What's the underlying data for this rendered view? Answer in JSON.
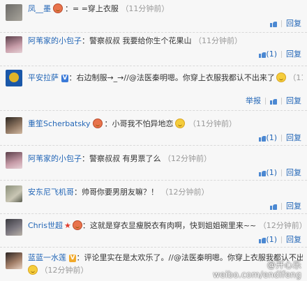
{
  "comments": [
    {
      "user": "凤__墨",
      "text": "= =穿上衣服",
      "time": "（11分钟前）",
      "like": "",
      "reply": "回复"
    },
    {
      "user": "阿苇家的小包子",
      "text": "警察叔叔 我要给你生个花果山",
      "time": "（11分钟前）",
      "like": "(1)",
      "reply": "回复"
    },
    {
      "user": "平安拉萨",
      "text": "右边制服→_→//@法医秦明",
      "text2": "嗯。你穿上衣服我都认不出来了",
      "time": "（11分钟前）",
      "report": "举报",
      "reply": "回复"
    },
    {
      "user": "重笙Scherbatsky",
      "text": "小哥我不怕异地恋",
      "time": "（11分钟前）",
      "like": "(1)",
      "reply": "回复"
    },
    {
      "user": "阿苇家的小包子",
      "text": "警察叔叔 有男票了么",
      "time": "（12分钟前）",
      "like": "(1)",
      "reply": "回复"
    },
    {
      "user": "安东尼飞机哥",
      "text": "帅哥你要男朋友嘛？！",
      "time": "（12分钟前）",
      "like": "",
      "reply": "回复"
    },
    {
      "user": "Chris世超",
      "text": "这就是穿衣显瘦脱衣有肉啊，快到姐姐碗里来~~",
      "time": "（12分钟前）",
      "like": "(1)",
      "reply": "回复"
    },
    {
      "user": "蓝蓝一水莲",
      "text": "评论里实在是太欢乐了。//@法医秦明",
      "text2": "嗯。你穿上衣服我都认不出来了",
      "time": "（12分钟前）",
      "like": "",
      "reply": ""
    }
  ],
  "watermark": {
    "top": "@开心乐",
    "url": "weibo.com/endifeng"
  }
}
